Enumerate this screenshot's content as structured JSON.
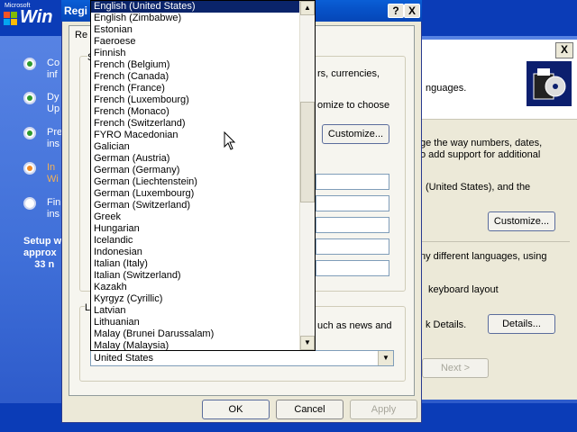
{
  "setup": {
    "logo_small": "Microsoft",
    "logo": "Win",
    "steps": [
      {
        "label": "Co",
        "label2": "inf",
        "state": "done"
      },
      {
        "label": "Dy",
        "label2": "Up",
        "state": "done"
      },
      {
        "label": "Pre",
        "label2": "ins",
        "state": "done"
      },
      {
        "label": "In",
        "label2": "Wi",
        "state": "current"
      },
      {
        "label": "Fin",
        "label2": "ins",
        "state": "pending"
      }
    ],
    "time_text": "Setup w\napprox\n    33 n"
  },
  "right_page": {
    "close": "X",
    "header_text": "nguages.",
    "text_currencies": "rs, currencies,",
    "text_customize_to_choose": "omize to choose",
    "text_numbers": "ge the way numbers, dates,",
    "text_support": "o add support for additional",
    "text_us": "(United States), and the",
    "customize_button": "Customize...",
    "customize_button_dialog": "Customize...",
    "text_languages": "ny different languages, using",
    "text_keyboard": "keyboard layout",
    "text_news": "uch as news and",
    "text_details": "k Details.",
    "details_button": "Details...",
    "next_button": "Next >"
  },
  "dialog": {
    "title": "Regi",
    "help_btn": "?",
    "close_btn": "X",
    "tab_text": "Re",
    "group_s": "S",
    "group_l": "L",
    "ok_button": "OK",
    "cancel_button": "Cancel",
    "apply_button": "Apply"
  },
  "dropdown": {
    "selected_value": "United States",
    "items": [
      "English (United States)",
      "English (Zimbabwe)",
      "Estonian",
      "Faeroese",
      "Finnish",
      "French (Belgium)",
      "French (Canada)",
      "French (France)",
      "French (Luxembourg)",
      "French (Monaco)",
      "French (Switzerland)",
      "FYRO Macedonian",
      "Galician",
      "German (Austria)",
      "German (Germany)",
      "German (Liechtenstein)",
      "German (Luxembourg)",
      "German (Switzerland)",
      "Greek",
      "Hungarian",
      "Icelandic",
      "Indonesian",
      "Italian (Italy)",
      "Italian (Switzerland)",
      "Kazakh",
      "Kyrgyz (Cyrillic)",
      "Latvian",
      "Lithuanian",
      "Malay (Brunei Darussalam)",
      "Malay (Malaysia)"
    ],
    "selected_index": 0,
    "scroll_up": "▲",
    "scroll_down": "▼",
    "combo_arrow": "▼"
  }
}
